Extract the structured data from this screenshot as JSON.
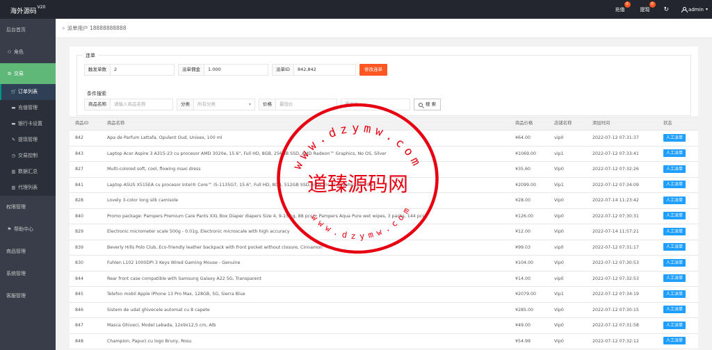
{
  "header": {
    "logo_text": "海外源码",
    "logo_version": "V20",
    "recharge_label": "充值",
    "recharge_count": "0",
    "withdraw_label": "提现",
    "withdraw_count": "0",
    "refresh_icon": "refresh-icon",
    "user_name": "admin"
  },
  "sidebar": {
    "items": [
      {
        "label": "后台首页",
        "icon": ""
      },
      {
        "label": "角色",
        "icon": "user-icon"
      },
      {
        "label": "交易",
        "icon": "gear-icon"
      },
      {
        "label": "订单列表",
        "icon": "cart-icon"
      },
      {
        "label": "充值管理",
        "icon": "card-icon"
      },
      {
        "label": "银行卡设置",
        "icon": "card-icon"
      },
      {
        "label": "提现管理",
        "icon": "wrench-icon"
      },
      {
        "label": "交易控制",
        "icon": "clock-icon"
      },
      {
        "label": "数据汇总",
        "icon": "chart-icon"
      },
      {
        "label": "代理列表",
        "icon": "chart-icon"
      },
      {
        "label": "权限管理",
        "icon": ""
      },
      {
        "label": "帮助中心",
        "icon": "flag-icon"
      },
      {
        "label": "商品管理",
        "icon": ""
      },
      {
        "label": "系统管理",
        "icon": ""
      },
      {
        "label": "客服管理",
        "icon": ""
      }
    ]
  },
  "breadcrumb": {
    "text": "派单用户 18888888888"
  },
  "dispatch": {
    "legend": "连单",
    "trigger_label": "触发单数",
    "trigger_value": "2",
    "commission_label": "派单佣金",
    "commission_value": "1.000",
    "order_id_label": "派单ID",
    "order_id_value": "842,842",
    "modify_button": "修改连单"
  },
  "search": {
    "title": "条件搜索",
    "name_label": "商品名称",
    "name_placeholder": "请输入商品名称",
    "category_label": "分类",
    "category_placeholder": "所有分类",
    "price_label": "价格",
    "price_min_placeholder": "最低价",
    "price_max_placeholder": "最高价",
    "search_button": "搜 索"
  },
  "table": {
    "columns": [
      "商品ID",
      "商品名称",
      "商品价格",
      "店铺名称",
      "添加时间",
      "状态"
    ],
    "rows": [
      {
        "id": "842",
        "name": "Apa de Parfum Lattafa, Opulent Oud, Unisex, 100 ml",
        "price": "¥64.00",
        "store": "vip0",
        "time": "2022-07-12 07:31:37",
        "status": "人工派单"
      },
      {
        "id": "843",
        "name": "Laptop Acer Aspire 3 A315-23 cu procesor AMD 3020e, 15.6\", Full HD, 8GB, 256GB SSD, AMD Radeon™ Graphics, No OS, Silver",
        "price": "¥1069.00",
        "store": "vip1",
        "time": "2022-07-12 07:33:41",
        "status": "人工派单"
      },
      {
        "id": "827",
        "name": "Multi-colored soft, cool, flowing maxi dress",
        "price": "¥35.60",
        "store": "Vip0",
        "time": "2022-07-12 07:32:26",
        "status": "人工派单"
      },
      {
        "id": "841",
        "name": "Laptop ASUS X515EA cu procesor Intel® Core™ i5-1135G7, 15.6\", Full HD, 8GB, 512GB SSD, Intel Iris Xᵉ Graphics, No OS",
        "price": "¥2099.00",
        "store": "Vip1",
        "time": "2022-07-12 07:34:09",
        "status": "人工派单"
      },
      {
        "id": "828",
        "name": "Lovely 3-color long silk camisole",
        "price": "¥28.00",
        "store": "Vip0",
        "time": "2022-07-14 11:23:42",
        "status": "人工派单"
      },
      {
        "id": "840",
        "name": "Promo package: Pampers Premium Care Pants XXL Box Diaper diapers Size 4, 9-15 kg, 88 pcs + Pampers Aqua Pure wet wipes, 3 packs, 144 pcs",
        "price": "¥126.00",
        "store": "Vip0",
        "time": "2022-07-12 07:30:31",
        "status": "人工派单"
      },
      {
        "id": "829",
        "name": "Electronic micrometer scale 500g - 0.01g, Electronic microscale with high accuracy",
        "price": "¥12.00",
        "store": "Vip0",
        "time": "2022-07-14 11:57:21",
        "status": "人工派单"
      },
      {
        "id": "839",
        "name": "Beverly Hills Polo Club, Eco-friendly leather backpack with front pocket without closure, Cinnamon",
        "price": "¥99.03",
        "store": "vip0",
        "time": "2022-07-12 07:31:17",
        "status": "人工派单"
      },
      {
        "id": "830",
        "name": "Fuhlen L102 1000DPI 3 Keys Wired Gaming Mouse - Genuine",
        "price": "¥104.00",
        "store": "Vip0",
        "time": "2022-07-12 07:30:53",
        "status": "人工派单"
      },
      {
        "id": "844",
        "name": "Rear front case compatible with Samsung Galaxy A22 5G, Transparent",
        "price": "¥14.00",
        "store": "vip0",
        "time": "2022-07-12 07:32:53",
        "status": "人工派单"
      },
      {
        "id": "845",
        "name": "Telefon mobil Apple iPhone 13 Pro Max, 128GB, 5G, Sierra Blue",
        "price": "¥2079.00",
        "store": "Vip1",
        "time": "2022-07-12 07:34:19",
        "status": "人工派单"
      },
      {
        "id": "846",
        "name": "Sistem de udat ghivecele automat cu 8 capete",
        "price": "¥285.00",
        "store": "Vip0",
        "time": "2022-07-12 07:30:15",
        "status": "人工派单"
      },
      {
        "id": "847",
        "name": "Masca Ghiveci, Model Lebada, 12x9x12,5 cm, Alb",
        "price": "¥49.00",
        "store": "Vip0",
        "time": "2022-07-12 07:31:58",
        "status": "人工派单"
      },
      {
        "id": "848",
        "name": "Champion, Papuci cu logo Bruny, Rosu",
        "price": "¥54.99",
        "store": "Vip0",
        "time": "2022-07-12 07:32:12",
        "status": "人工派单"
      }
    ]
  },
  "watermark": {
    "center_text": "道臻源码网",
    "ring_text": "www.dzymw.com"
  },
  "colors": {
    "topbar": "#23262e",
    "sidebar": "#393d49",
    "active_group": "#5fb878",
    "badge": "#ff5722",
    "status_button": "#1e9fff",
    "seal_red": "#e60012"
  }
}
